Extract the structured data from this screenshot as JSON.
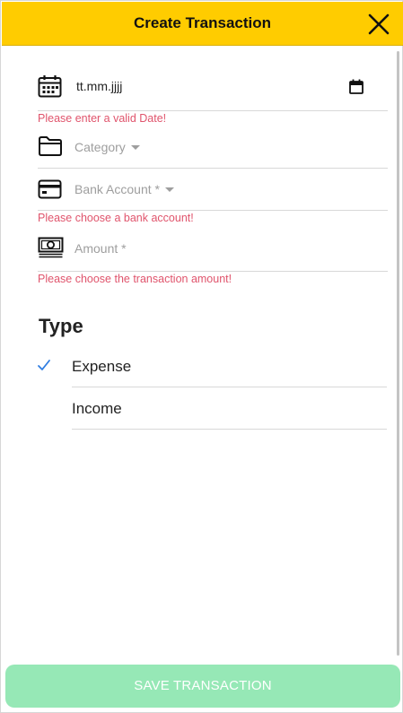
{
  "header": {
    "title": "Create Transaction",
    "close_icon": "close-icon",
    "background": "#ffcc00"
  },
  "form": {
    "date": {
      "value": "tt.mm.jjjj",
      "icon": "calendar-icon",
      "picker_icon": "calendar-picker-icon",
      "error": "Please enter a valid Date!"
    },
    "category": {
      "placeholder": "Category",
      "icon": "folder-icon"
    },
    "bank_account": {
      "placeholder": "Bank Account *",
      "icon": "credit-card-icon",
      "error": "Please choose a bank account!"
    },
    "amount": {
      "placeholder": "Amount *",
      "icon": "cash-icon",
      "error": "Please choose the transaction amount!"
    }
  },
  "type_section": {
    "heading": "Type",
    "options": [
      {
        "label": "Expense",
        "selected": true
      },
      {
        "label": "Income",
        "selected": false
      }
    ],
    "check_icon": "checkmark-icon"
  },
  "footer": {
    "save_label": "SAVE TRANSACTION",
    "save_color": "#96e8b6"
  },
  "colors": {
    "error": "#e0546c",
    "check": "#2f7de1"
  }
}
